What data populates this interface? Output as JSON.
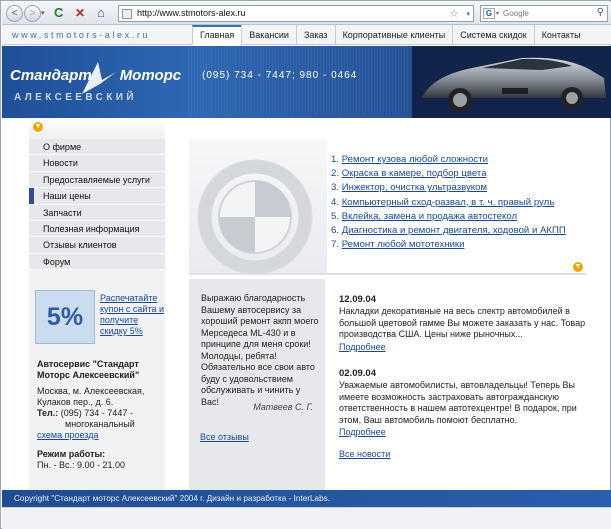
{
  "browser": {
    "back_glyph": "<",
    "forward_glyph": ">",
    "dropdown_glyph": "▾",
    "reload_glyph": "C",
    "stop_glyph": "✕",
    "home_glyph": "⌂",
    "url": "http://www.stmotors-alex.ru",
    "star_glyph": "☆",
    "search_engine_glyph": "G",
    "search_placeholder": "Google",
    "search_glyph": "⚲"
  },
  "site": {
    "domain": "www.stmotors-alex.ru",
    "phone": "(095) 734 - 7447;  980 - 0464",
    "logo": {
      "line1_left": "Стандарт",
      "line1_right": "Моторс",
      "line2": "АЛЕКСЕЕВСКИЙ"
    },
    "colors": {
      "brand_blue": "#2a5fae",
      "link": "#1a48a0",
      "accent_orange": "#f0a800"
    }
  },
  "main_nav": [
    {
      "label": "Главная",
      "active": true
    },
    {
      "label": "Вакансии"
    },
    {
      "label": "Заказ"
    },
    {
      "label": "Корпоративные клиенты"
    },
    {
      "label": "Система скидок"
    },
    {
      "label": "Контакты"
    }
  ],
  "side_menu": [
    {
      "label": "О фирме"
    },
    {
      "label": "Новости"
    },
    {
      "label": "Предоставляемые услуги"
    },
    {
      "label": "Наши цены",
      "active": true
    },
    {
      "label": "Запчасти"
    },
    {
      "label": "Полезная информация"
    },
    {
      "label": "Отзывы клиентов"
    },
    {
      "label": "Форум"
    }
  ],
  "promo": {
    "badge": "5%",
    "text": "Распечатайте купон с сайта и получите скидку 5%"
  },
  "contact": {
    "title": "Автосервис \"Стандарт Моторс Алексеевский\"",
    "address_1": "Москва, м. Алексеевская,",
    "address_2": "Кулаков пер., д. 6.",
    "tel_label": "Тел.:",
    "tel_value": " (095) 734 - 7447 -",
    "tel_note": "многоканальный",
    "map_link": "схема проезда",
    "hours_label": "Режим работы:",
    "hours_value": "Пн. - Вс.: 9.00 - 21.00"
  },
  "services": [
    {
      "num": "1.",
      "text": "Ремонт кузова любой сложности"
    },
    {
      "num": "2.",
      "text": "Окраска в камере, подбор цвета"
    },
    {
      "num": "3.",
      "text": "Инжектор, очистка  ультразвуком"
    },
    {
      "num": "4.",
      "text": "Компьютерный сход-развал, в т. ч. правый  руль"
    },
    {
      "num": "5.",
      "text": "Вклейка, замена и продажа автостекол"
    },
    {
      "num": "6.",
      "text": "Диагностика и ремонт двигателя, ходовой и АКПП"
    },
    {
      "num": "7.",
      "text": " Ремонт любой мототехники"
    }
  ],
  "review": {
    "text": "Выражаю благодарность Вашему автосервису за хороший ремонт акпп моего Мерседеса ML-430 и в принципе для меня сроки! Молодцы, ребята! Обязательно все свои авто буду с удовольствием обслуживать и чинить у Вас!",
    "author": "Матвеев С. Г.",
    "all_link": "Все отзывы"
  },
  "news": [
    {
      "date": "12.09.04",
      "text": "Накладки декоративные на весь спектр автомобилей в большой цветовой гамме Вы можете заказать у нас. Товар производства США. Цены ниже рыночных...",
      "more": "Подробнее"
    },
    {
      "date": "02.09.04",
      "text": "Уважаемые автомобилисты, автовладельцы! Теперь Вы имеете возможность застраховать автогражданскую ответственность в нашем автотехцентре! В подарок, при этом, Ваш автомобиль помоют бесплатно.",
      "more": "Подробнее"
    }
  ],
  "news_all_link": "Все новости",
  "footer": "Copyright  \"Стандарт моторс Алексеевский\" 2004 г.   Дизайн и разработка - InterLabs."
}
